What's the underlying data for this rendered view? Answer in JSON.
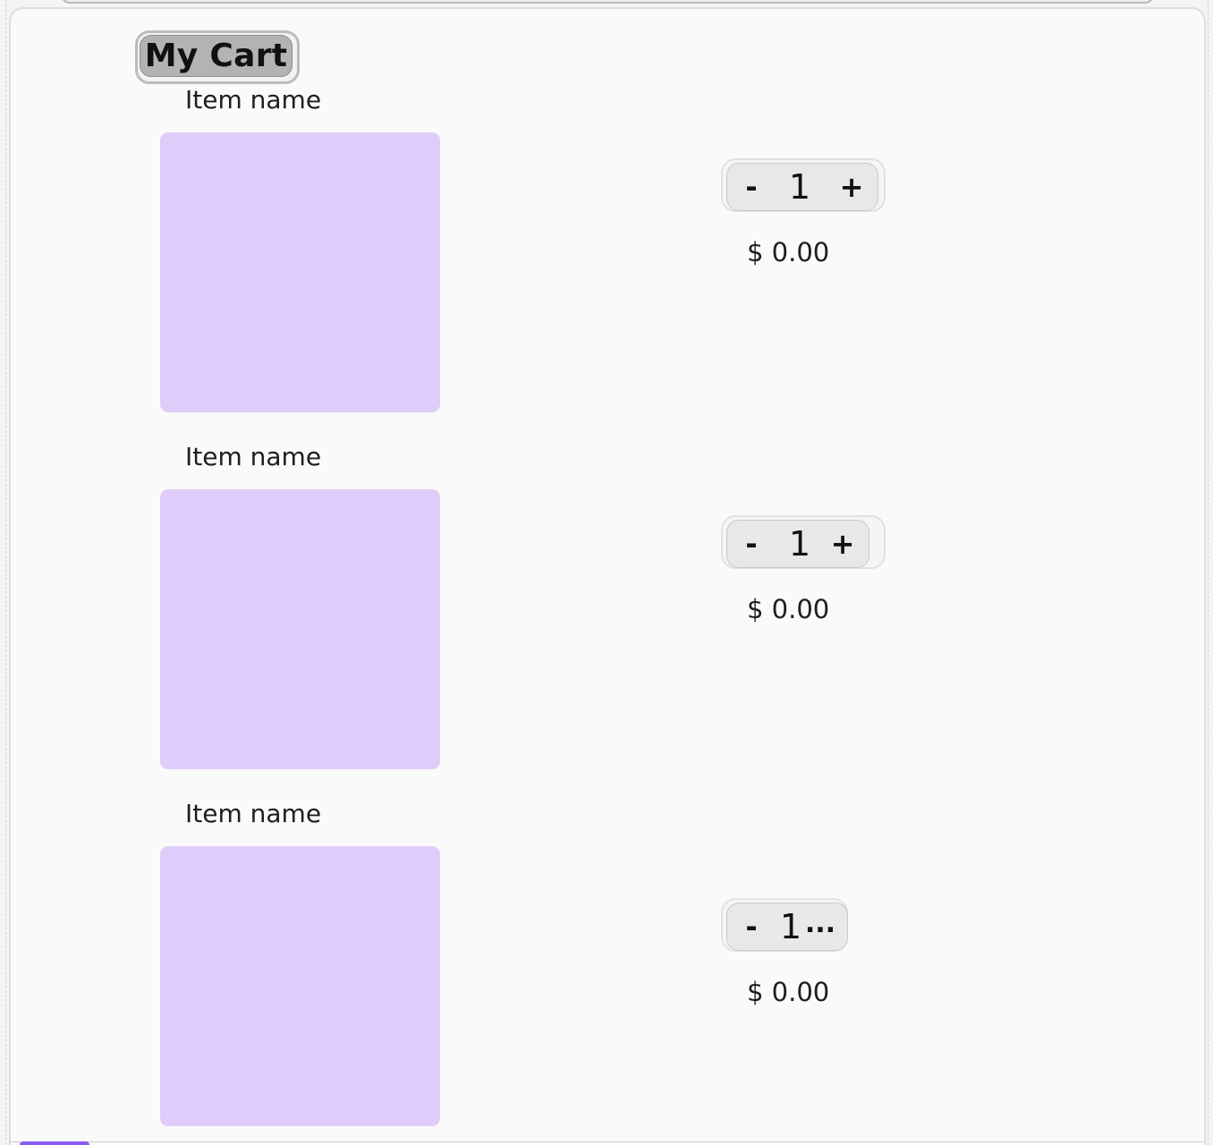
{
  "cart": {
    "title": "My Cart",
    "items": [
      {
        "name": "Item name",
        "quantity": "1",
        "minus_label": "-",
        "plus_label": "+",
        "price": "$ 0.00"
      },
      {
        "name": "Item name",
        "quantity": "1",
        "minus_label": "-",
        "plus_label": "+",
        "price": "$ 0.00"
      },
      {
        "name": "Item name",
        "quantity": "1",
        "minus_label": "-",
        "overflow_label": "...",
        "price": "$ 0.00"
      }
    ]
  },
  "colors": {
    "image_placeholder": "#e0ccfa",
    "accent": "#8b5cf6"
  }
}
